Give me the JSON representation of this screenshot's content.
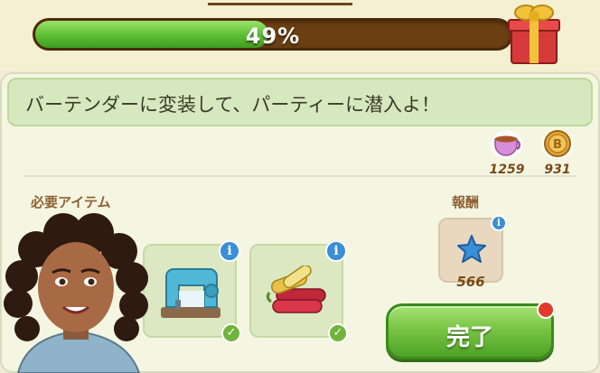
{
  "progress": {
    "value": 0.49,
    "label": "49%"
  },
  "banner": {
    "text": "バーテンダーに変装して、パーティーに潜入よ！"
  },
  "currencies": [
    {
      "icon": "tea-cup-icon",
      "amount": "1259"
    },
    {
      "icon": "coin-icon",
      "amount": "931"
    }
  ],
  "required_items_label": "必要アイテム",
  "reward_label": "報酬",
  "items": [
    {
      "icon": "sewing-machine-icon",
      "completed": true
    },
    {
      "icon": "fabric-rolls-icon",
      "completed": true
    }
  ],
  "reward": {
    "icon": "blue-star-icon",
    "amount": "566"
  },
  "done_button": {
    "label": "完了"
  },
  "colors": {
    "progress_fill": "#5cbd33",
    "progress_track": "#6b3f12",
    "button_green": "#78c544",
    "info_blue": "#3a8fd6"
  }
}
